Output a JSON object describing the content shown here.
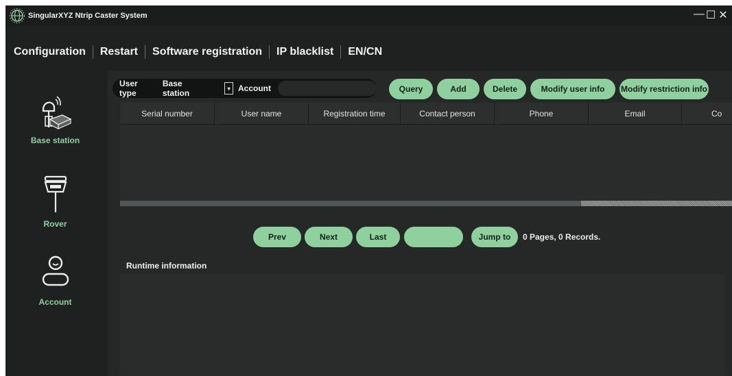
{
  "window": {
    "title": "SingularXYZ Ntrip Caster System",
    "controls": {
      "minimize": "—",
      "maximize": "☐",
      "close": "✕"
    }
  },
  "menu": [
    "Configuration",
    "Restart",
    "Software registration",
    "IP blacklist",
    "EN/CN"
  ],
  "sidebar": {
    "items": [
      {
        "label": "Base station",
        "icon": "base-station-icon"
      },
      {
        "label": "Rover",
        "icon": "rover-icon"
      },
      {
        "label": "Account",
        "icon": "account-icon"
      }
    ]
  },
  "filter": {
    "user_type_label": "User type",
    "user_type_value": "Base station",
    "account_label": "Account",
    "account_value": ""
  },
  "actions": {
    "query": "Query",
    "add": "Add",
    "delete": "Delete",
    "modify_user_info": "Modify user info",
    "modify_restriction_info": "Modify restriction info"
  },
  "table": {
    "columns": [
      "Serial number",
      "User name",
      "Registration time",
      "Contact person",
      "Phone",
      "Email",
      "Co"
    ],
    "rows": []
  },
  "pager": {
    "prev": "Prev",
    "next": "Next",
    "last": "Last",
    "page_input": "",
    "jump": "Jump to",
    "status": "0 Pages, 0 Records."
  },
  "runtime": {
    "title": "Runtime information",
    "text": ""
  },
  "colors": {
    "accent": "#8fd19e",
    "background": "#1f2120",
    "panel": "#262827"
  }
}
